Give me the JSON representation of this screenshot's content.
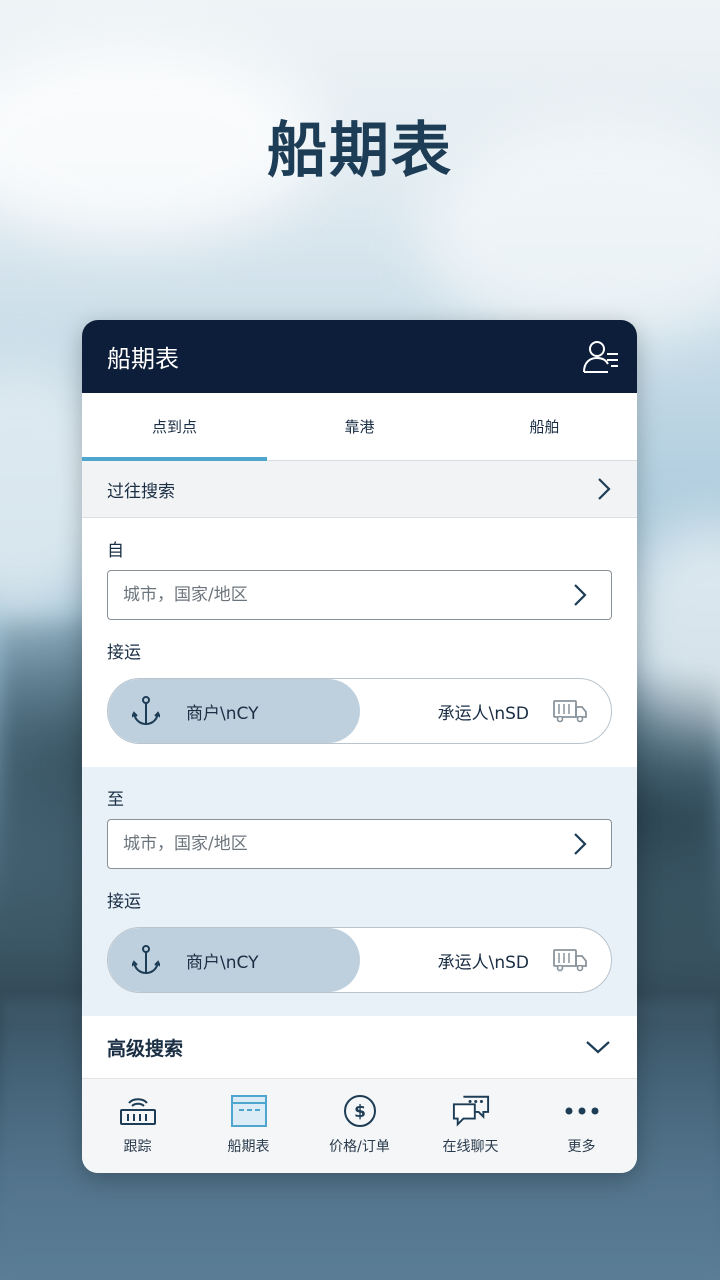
{
  "page": {
    "heading": "船期表"
  },
  "header": {
    "title": "船期表",
    "profile_icon": "user-menu-icon"
  },
  "tabs": [
    {
      "label": "点到点",
      "active": true
    },
    {
      "label": "靠港",
      "active": false
    },
    {
      "label": "船舶",
      "active": false
    }
  ],
  "history": {
    "label": "过往搜索"
  },
  "from": {
    "label": "自",
    "placeholder": "城市，国家/地区",
    "transport_label": "接运",
    "option_merchant": "商户\\nCY",
    "option_carrier": "承运人\\nSD"
  },
  "to": {
    "label": "至",
    "placeholder": "城市，国家/地区",
    "transport_label": "接运",
    "option_merchant": "商户\\nCY",
    "option_carrier": "承运人\\nSD"
  },
  "advanced": {
    "label": "高级搜索"
  },
  "nav": [
    {
      "label": "跟踪",
      "icon": "tracking-icon"
    },
    {
      "label": "船期表",
      "icon": "schedule-icon"
    },
    {
      "label": "价格/订单",
      "icon": "dollar-icon"
    },
    {
      "label": "在线聊天",
      "icon": "chat-icon"
    },
    {
      "label": "更多",
      "icon": "more-icon"
    }
  ],
  "colors": {
    "header_bg": "#0c1e3a",
    "accent": "#4ea6cf",
    "selected_toggle": "#bed0de",
    "to_section_bg": "#e8f1f7"
  }
}
